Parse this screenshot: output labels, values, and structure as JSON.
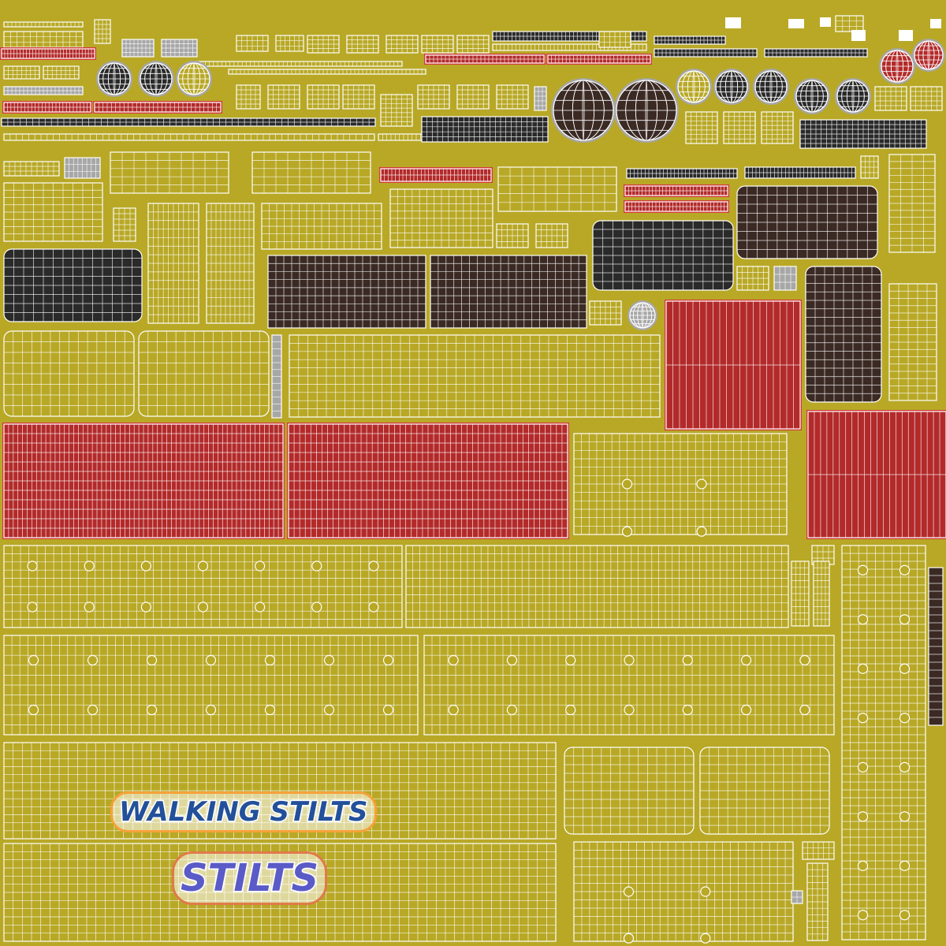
{
  "texture": {
    "logos": {
      "walking_stilts": "WALKING STILTS",
      "stilts": "STILTS"
    },
    "colors": {
      "yellow": "#b8a826",
      "yellow_dark": "#a89a1c",
      "red": "#b32a2a",
      "red_border": "#d23a3a",
      "dark_brown": "#3b2a24",
      "black": "#2a2a2a",
      "gray": "#a7a7a7",
      "wire": "#ffffff",
      "logo_blue": "#23509a",
      "logo_purple": "#5a5bc7",
      "logo_orange": "#f5a23a"
    }
  }
}
